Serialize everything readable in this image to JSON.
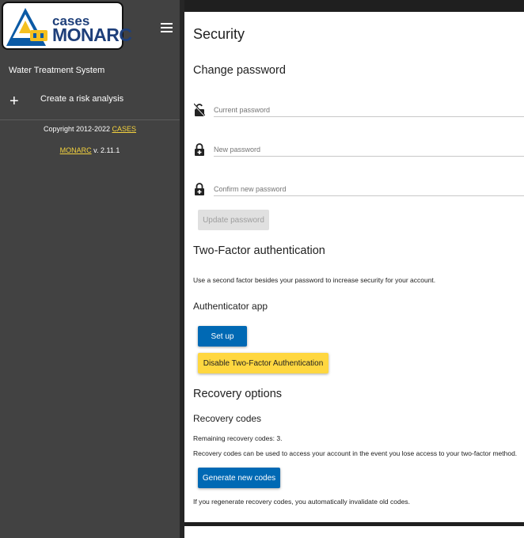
{
  "sidebar": {
    "logo": {
      "small_text": "cases",
      "big_text": "MONARC"
    },
    "analysis_name": "Water Treatment System",
    "create_label": "Create a risk analysis",
    "copyright_prefix": "Copyright 2012-2022",
    "copyright_link": "CASES",
    "version_link": "MONARC",
    "version_text": "v. 2.11.1"
  },
  "main": {
    "title": "Security",
    "change_password": {
      "heading": "Change password",
      "fields": [
        {
          "label": "Current password",
          "icon": "lock-open-icon"
        },
        {
          "label": "New password",
          "icon": "lock-plus-icon"
        },
        {
          "label": "Confirm new password",
          "icon": "lock-plus-icon"
        }
      ],
      "update_button": "Update password"
    },
    "two_factor": {
      "heading": "Two-Factor authentication",
      "description": "Use a second factor besides your password to increase security for your account.",
      "authenticator_heading": "Authenticator app",
      "setup_button": "Set up",
      "disable_button": "Disable Two-Factor Authentication"
    },
    "recovery": {
      "heading": "Recovery options",
      "codes_heading": "Recovery codes",
      "remaining": "Remaining recovery codes: 3.",
      "info": "Recovery codes can be used to access your account in the event you lose access to your two-factor method.",
      "generate_button": "Generate new codes",
      "warning": "If you regenerate recovery codes, you automatically invalidate old codes."
    }
  },
  "colors": {
    "sidebar": "#424242",
    "primary": "#0069b4",
    "accent": "#ffd740",
    "link": "#f5d33e"
  }
}
